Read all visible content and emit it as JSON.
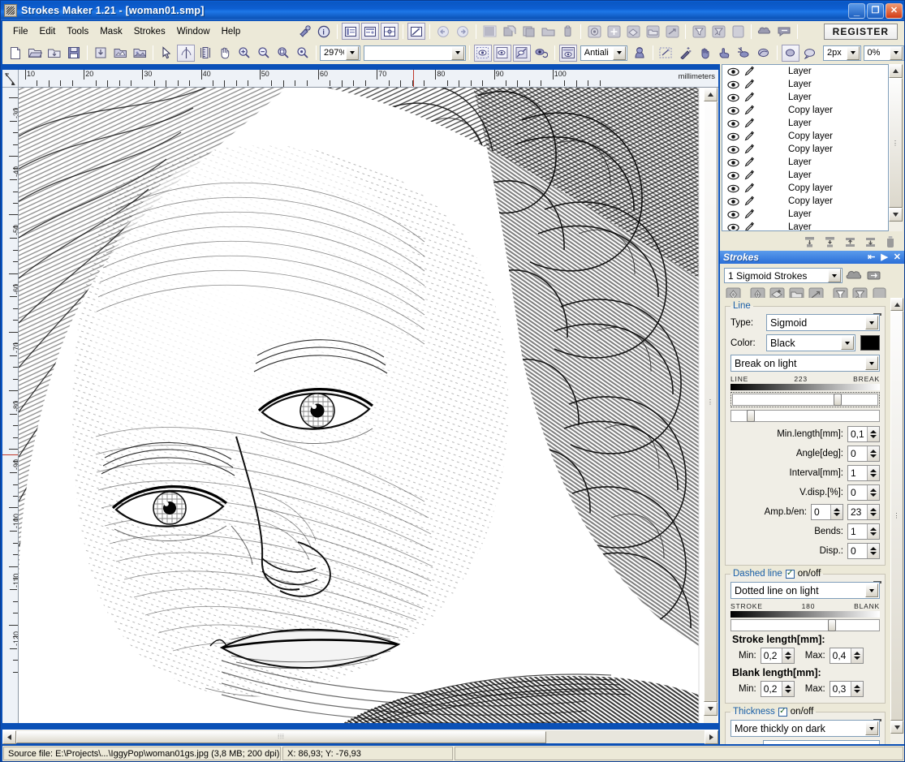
{
  "window": {
    "title": "Strokes Maker 1.21 - [woman01.smp]",
    "app_icon": "app-icon",
    "buttons": {
      "minimize": "_",
      "maximize": "❐",
      "close": "✕"
    }
  },
  "menubar": {
    "items": [
      "File",
      "Edit",
      "Tools",
      "Mask",
      "Strokes",
      "Window",
      "Help"
    ],
    "icons_group1": [
      "brush-info-icon",
      "info-icon"
    ],
    "icons_group2": [
      "layers-list-icon",
      "properties-icon",
      "grid-center-icon"
    ],
    "icons_group3": [
      "edit-line-icon"
    ],
    "icons_group4": [
      "back-arrow-icon",
      "forward-arrow-icon"
    ],
    "icons_group5": [
      "hatch-icon",
      "copy-icon",
      "paste-icon",
      "folder-icon",
      "delete-icon"
    ],
    "icons_group6": [
      "target-icon",
      "add-node-icon",
      "add-layer-icon",
      "open-layer-icon",
      "arrow-layer-icon"
    ],
    "icons_group7": [
      "filter-icon",
      "filter-clear-icon",
      "page-icon"
    ],
    "icons_group8": [
      "cloud-icon",
      "speech-icon"
    ],
    "register_label": "REGISTER"
  },
  "toolbar": {
    "file_icons": [
      "new-document-icon",
      "open-folder-icon",
      "import-icon",
      "save-icon"
    ],
    "export_icons": [
      "save-as-icon",
      "image-in-icon",
      "image-out-icon"
    ],
    "tool_icons": [
      "pointer-icon",
      "brush-tool-icon",
      "measure-icon",
      "hand-icon",
      "zoom-in-icon",
      "zoom-out-icon",
      "zoom-fit-icon",
      "zoom-actual-icon"
    ],
    "zoom_value": "297%",
    "preset_value": "",
    "view_icons": [
      "preview-select-icon",
      "preview-page-icon",
      "preview-strokes-icon",
      "preview-refresh-icon"
    ],
    "render_icon": "render-preview-icon",
    "antialias_value": "Antiali",
    "face_icon": "portrait-icon",
    "mask_icons": [
      "mask-rect-icon",
      "magic-wand-icon",
      "hand-mask-icon",
      "finger-icon",
      "ray-icon",
      "blob-icon"
    ],
    "blob_icons": [
      "blob-filled-icon",
      "blob-outline-icon"
    ],
    "pen_width_value": "2px",
    "opacity_value": "0%"
  },
  "rulers": {
    "h_unit": "millimeters",
    "h_labels": [
      "10",
      "20",
      "30",
      "40",
      "50",
      "60",
      "70",
      "80",
      "90",
      "100"
    ],
    "v_labels": [
      "-30",
      "-40",
      "-50",
      "-60",
      "-70",
      "-80",
      "-90",
      "-100",
      "-110",
      "-120"
    ]
  },
  "layers": {
    "rows": [
      {
        "eye": "eye-icon",
        "pen": "pencil-icon",
        "name": "Layer"
      },
      {
        "eye": "eye-icon",
        "pen": "pencil-icon",
        "name": "Layer"
      },
      {
        "eye": "eye-icon",
        "pen": "pencil-icon",
        "name": "Layer"
      },
      {
        "eye": "eye-icon",
        "pen": "pencil-icon",
        "name": "Copy layer"
      },
      {
        "eye": "eye-icon",
        "pen": "pencil-icon",
        "name": "Layer"
      },
      {
        "eye": "eye-icon",
        "pen": "pencil-icon",
        "name": "Copy layer"
      },
      {
        "eye": "eye-icon",
        "pen": "pencil-icon",
        "name": "Copy layer"
      },
      {
        "eye": "eye-icon",
        "pen": "pencil-icon",
        "name": "Layer"
      },
      {
        "eye": "eye-icon",
        "pen": "pencil-icon",
        "name": "Layer"
      },
      {
        "eye": "eye-icon",
        "pen": "pencil-icon",
        "name": "Copy layer"
      },
      {
        "eye": "eye-icon",
        "pen": "pencil-icon",
        "name": "Copy layer"
      },
      {
        "eye": "eye-icon",
        "pen": "pencil-icon",
        "name": "Layer"
      },
      {
        "eye": "eye-icon",
        "pen": "pencil-icon",
        "name": "Layer"
      }
    ],
    "tool_icons": [
      "align-top-icon",
      "align-middle-icon",
      "align-up-icon",
      "align-down-icon",
      "trash-icon"
    ]
  },
  "strokes_panel": {
    "title": "Strokes",
    "title_actions": [
      "dock-icon",
      "play-icon",
      "close-icon"
    ],
    "preset": "1 Sigmoid Strokes",
    "preset_icons": [
      "cloud-add-icon",
      "cloud-remove-icon"
    ],
    "tool_icons": [
      "gem-icon",
      "node-add-icon",
      "layer-add-icon",
      "layer-open-icon",
      "layer-arrow-icon",
      "funnel-icon",
      "funnel-alt-icon",
      "page-icon"
    ],
    "line": {
      "legend": "Line",
      "type_label": "Type:",
      "type_value": "Sigmoid",
      "color_label": "Color:",
      "color_value": "Black",
      "color_hex": "#000000",
      "mode_value": "Break on light",
      "grad_left": "LINE",
      "grad_mid": "223",
      "grad_right": "BREAK",
      "slider1_pct": 74,
      "slider2_pct": 11,
      "fields": [
        {
          "label": "Min.length[mm]:",
          "value": "0,1"
        },
        {
          "label": "Angle[deg]:",
          "value": "0"
        },
        {
          "label": "Interval[mm]:",
          "value": "1"
        },
        {
          "label": "V.disp.[%]:",
          "value": "0"
        }
      ],
      "amp_label": "Amp.b/en:",
      "amp_begin": "0",
      "amp_end": "23",
      "bends_label": "Bends:",
      "bends_value": "1",
      "disp_label": "Disp.:",
      "disp_value": "0"
    },
    "dashed": {
      "legend": "Dashed line",
      "onoff_label": "on/off",
      "onoff_checked": true,
      "mode_value": "Dotted line on light",
      "grad_left": "STROKE",
      "grad_mid": "180",
      "grad_right": "BLANK",
      "slider_pct": 69,
      "stroke_length_label": "Stroke length[mm]:",
      "stroke_min_label": "Min:",
      "stroke_min": "0,2",
      "stroke_max_label": "Max:",
      "stroke_max": "0,4",
      "blank_length_label": "Blank length[mm]:",
      "blank_min_label": "Min:",
      "blank_min": "0,2",
      "blank_max_label": "Max:",
      "blank_max": "0,3"
    },
    "thickness": {
      "legend": "Thickness",
      "onoff_label": "on/off",
      "onoff_checked": true,
      "mode_value": "More thickly on dark"
    }
  },
  "statusbar": {
    "source": "Source file: E:\\Projects\\...\\IggyPop\\woman01gs.jpg (3,8 MB; 200 dpi)",
    "coords": "X: 86,93; Y: -76,93"
  },
  "colors": {
    "titlebar": "#0a57c4",
    "panel_bg": "#ece9d8",
    "legend_text": "#1a5fa8",
    "accent": "#316ac5"
  }
}
